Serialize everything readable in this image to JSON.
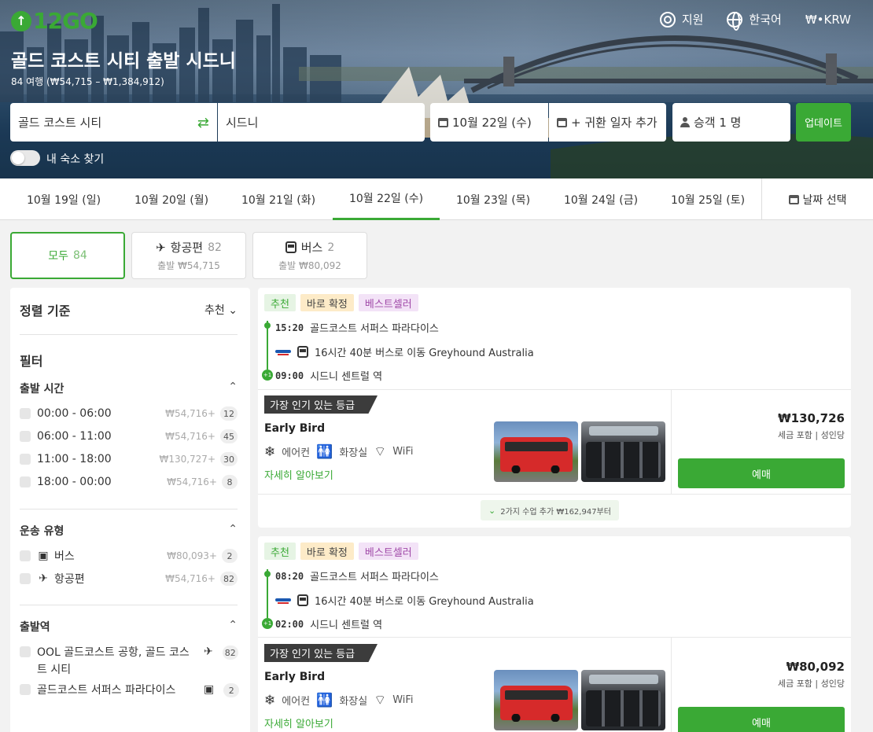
{
  "app": {
    "logo": "12GO"
  },
  "nav": {
    "support": "지원",
    "language": "한국어",
    "currency": "₩•KRW"
  },
  "hero": {
    "title": "골드 코스트 시티 출발 시드니",
    "subtitle": "84 여행 (₩54,715 – ₩1,384,912)"
  },
  "search": {
    "from": "골드 코스트 시티",
    "to": "시드니",
    "date": "10월 22일 (수)",
    "return": "+ 귀환 일자 추가",
    "passengers": "승객 1 명",
    "update": "업데이트",
    "toggle_label": "내 숙소 찾기"
  },
  "dates": [
    {
      "label": "10월 19일 (일)"
    },
    {
      "label": "10월 20일 (월)"
    },
    {
      "label": "10월 21일 (화)"
    },
    {
      "label": "10월 22일 (수)",
      "active": true
    },
    {
      "label": "10월 23일 (목)"
    },
    {
      "label": "10월 24일 (금)"
    },
    {
      "label": "10월 25일 (토)"
    }
  ],
  "date_pick": "날짜 선택",
  "modes": {
    "all": {
      "label": "모두",
      "count": "84"
    },
    "air": {
      "label": "항공편",
      "count": "82",
      "from": "출발 ₩54,715"
    },
    "bus": {
      "label": "버스",
      "count": "2",
      "from": "출발 ₩80,092"
    }
  },
  "sidebar": {
    "sort_label": "정렬 기준",
    "sort_value": "추천",
    "filter_label": "필터",
    "departure_time": {
      "title": "출발 시간",
      "items": [
        {
          "label": "00:00 - 06:00",
          "price": "₩54,716+",
          "count": "12"
        },
        {
          "label": "06:00 - 11:00",
          "price": "₩54,716+",
          "count": "45"
        },
        {
          "label": "11:00 - 18:00",
          "price": "₩130,727+",
          "count": "30"
        },
        {
          "label": "18:00 - 00:00",
          "price": "₩54,716+",
          "count": "8"
        }
      ]
    },
    "transport_type": {
      "title": "운송 유형",
      "items": [
        {
          "label": "버스",
          "price": "₩80,093+",
          "count": "2"
        },
        {
          "label": "항공편",
          "price": "₩54,716+",
          "count": "82"
        }
      ]
    },
    "departure_station": {
      "title": "출발역",
      "items": [
        {
          "label": "OOL 골드코스트 공항, 골드 코스트 시티",
          "count": "82"
        },
        {
          "label": "골드코스트 서퍼스 파라다이스",
          "count": "2"
        }
      ]
    }
  },
  "results": [
    {
      "badges": [
        "추천",
        "바로 확정",
        "베스트셀러"
      ],
      "dep_time": "15:20",
      "dep_station": "골드코스트 서퍼스 파라다이스",
      "duration": "16시간 40분 버스로 이동 Greyhound Australia",
      "arr_time": "09:00",
      "arr_station": "시드니 센트럴 역",
      "next_day": "+1",
      "class_tag": "가장 인기 있는 등급",
      "fare_name": "Early Bird",
      "amenities": [
        "에어컨",
        "화장실",
        "WiFi"
      ],
      "learn_more": "자세히 알아보기",
      "price": "₩130,726",
      "price_note": "세금 포함 | 성인당",
      "book": "예매",
      "more": "2가지 수업 추가 ₩162,947부터"
    },
    {
      "badges": [
        "추천",
        "바로 확정",
        "베스트셀러"
      ],
      "dep_time": "08:20",
      "dep_station": "골드코스트 서퍼스 파라다이스",
      "duration": "16시간 40분 버스로 이동 Greyhound Australia",
      "arr_time": "02:00",
      "arr_station": "시드니 센트럴 역",
      "next_day": "+1",
      "class_tag": "가장 인기 있는 등급",
      "fare_name": "Early Bird",
      "amenities": [
        "에어컨",
        "화장실",
        "WiFi"
      ],
      "learn_more": "자세히 알아보기",
      "price": "₩80,092",
      "price_note": "세금 포함 | 성인당",
      "book": "예매"
    }
  ]
}
